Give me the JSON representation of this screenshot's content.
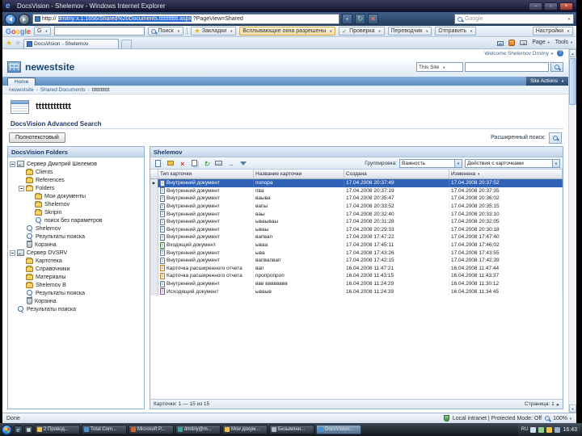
{
  "titlebar": {
    "title": "DocsVision - Shelemov - Windows Internet Explorer"
  },
  "addressbar": {
    "url_prefix": "http://",
    "url_selected": "dmitriy:x.1:1656/Shared%20Documents.tttttttttttt.aspx",
    "url_suffix": "?PageView=Shared",
    "search_placeholder": "Google"
  },
  "google_toolbar": {
    "logo": [
      "G",
      "o",
      "o",
      "g",
      "l",
      "e"
    ],
    "g_button": "G",
    "search_value": "",
    "search_button": "Поиск",
    "bookmarks": "Закладки",
    "popups": "Всплывающие окна разрешены",
    "check": "Проверка",
    "translate": "Переводчик",
    "send": "Отправить",
    "settings": "Настройки"
  },
  "command_bar": {
    "tab_title": "DocsVision - Shelemov",
    "page_menu": "Page",
    "tools_menu": "Tools"
  },
  "portal": {
    "welcome": "Welcome Shelemov Dmitriy",
    "site_title": "newestsite",
    "search_scope": "This Site",
    "nav_home": "Home",
    "site_actions": "Site Actions",
    "breadcrumb": [
      "newestsite",
      "Shared Documents",
      "tttttttttttt"
    ],
    "page_title": "tttttttttttt"
  },
  "search_section": {
    "title": "DocsVision Advanced Search",
    "fulltext_button": "Полнотекстовый",
    "advanced_label": "Расширенный поиск:"
  },
  "folders_panel": {
    "title": "DocsVision Folders",
    "items": [
      {
        "label": "Сервер Дмитрий Шелемов",
        "level": 0,
        "icon": "server",
        "exp": "minus"
      },
      {
        "label": "Clients",
        "level": 1,
        "icon": "folder",
        "exp": "leaf"
      },
      {
        "label": "References",
        "level": 1,
        "icon": "folder",
        "exp": "leaf"
      },
      {
        "label": "Folders",
        "level": 1,
        "icon": "folder-open",
        "exp": "minus"
      },
      {
        "label": "Мои документы",
        "level": 2,
        "icon": "folder",
        "exp": "leaf"
      },
      {
        "label": "Shelemov",
        "level": 2,
        "icon": "folder",
        "exp": "leaf"
      },
      {
        "label": "Skripin",
        "level": 2,
        "icon": "folder",
        "exp": "leaf"
      },
      {
        "label": "поиск без параметров",
        "level": 2,
        "icon": "search",
        "exp": "leaf"
      },
      {
        "label": "Shelemov",
        "level": 1,
        "icon": "search",
        "exp": "leaf"
      },
      {
        "label": "Результаты поиска",
        "level": 1,
        "icon": "search",
        "exp": "leaf"
      },
      {
        "label": "Корзина",
        "level": 1,
        "icon": "bin",
        "exp": "leaf"
      },
      {
        "label": "Сервер DVSRV",
        "level": 0,
        "icon": "server",
        "exp": "minus"
      },
      {
        "label": "Картотека",
        "level": 1,
        "icon": "folder",
        "exp": "leaf"
      },
      {
        "label": "Справочники",
        "level": 1,
        "icon": "folder",
        "exp": "leaf"
      },
      {
        "label": "Материалы",
        "level": 1,
        "icon": "folder",
        "exp": "leaf"
      },
      {
        "label": "Shelemov B",
        "level": 1,
        "icon": "folder",
        "exp": "leaf"
      },
      {
        "label": "Результаты поиска",
        "level": 1,
        "icon": "search",
        "exp": "leaf"
      },
      {
        "label": "Корзина",
        "level": 1,
        "icon": "bin",
        "exp": "leaf"
      },
      {
        "label": "Результаты поиска",
        "level": 0,
        "icon": "search",
        "exp": "leaf"
      }
    ]
  },
  "grid_panel": {
    "title": "Shelemov",
    "toolbar_icons": [
      "new-card",
      "open-card",
      "delete-card",
      "copy-card",
      "refresh",
      "print",
      "export",
      "filter"
    ],
    "grouping_label": "Группировка:",
    "grouping_value": "Важность",
    "actions_value": "Действия с карточками",
    "columns": [
      "Тип карточки",
      "Название карточки",
      "Создана",
      "Изменена"
    ],
    "rows": [
      {
        "type": "Внутренний документ",
        "name": "попора",
        "created": "17.04.2008 20:37:49",
        "modified": "17.04.2008 20:37:52",
        "icon": "doc",
        "selected": true
      },
      {
        "type": "Внутренний документ",
        "name": "пва",
        "created": "17.04.2008 20:37:19",
        "modified": "17.04.2008 20:37:35",
        "icon": "doc",
        "selected": false
      },
      {
        "type": "Внутренний документ",
        "name": "ваыва",
        "created": "17.04.2008 20:35:47",
        "modified": "17.04.2008 20:36:02",
        "icon": "doc",
        "selected": false
      },
      {
        "type": "Внутренний документ",
        "name": "вапы",
        "created": "17.04.2008 20:33:52",
        "modified": "17.04.2008 20:35:15",
        "icon": "doc",
        "selected": false
      },
      {
        "type": "Внутренний документ",
        "name": "ваы",
        "created": "17.04.2008 20:32:40",
        "modified": "17.04.2008 20:33:10",
        "icon": "doc",
        "selected": false
      },
      {
        "type": "Внутренний документ",
        "name": "ываываы",
        "created": "17.04.2008 20:31:28",
        "modified": "17.04.2008 20:32:05",
        "icon": "doc",
        "selected": false
      },
      {
        "type": "Внутренний документ",
        "name": "ываы",
        "created": "17.04.2008 20:29:33",
        "modified": "17.04.2008 20:30:18",
        "icon": "doc",
        "selected": false
      },
      {
        "type": "Внутренний документ",
        "name": "вапвап",
        "created": "17.04.2008 17:47:22",
        "modified": "17.04.2008 17:47:40",
        "icon": "doc",
        "selected": false
      },
      {
        "type": "Входящий документ",
        "name": "ываа",
        "created": "17.04.2008 17:45:11",
        "modified": "17.04.2008 17:46:02",
        "icon": "in",
        "selected": false
      },
      {
        "type": "Внутренний документ",
        "name": "ыва",
        "created": "17.04.2008 17:43:26",
        "modified": "17.04.2008 17:43:55",
        "icon": "doc",
        "selected": false
      },
      {
        "type": "Внутренний документ",
        "name": "вапвапвап",
        "created": "17.04.2008 17:42:15",
        "modified": "17.04.2008 17:42:39",
        "icon": "doc",
        "selected": false
      },
      {
        "type": "Карточка расширенного отчета",
        "name": "вап",
        "created": "16.04.2008 11:47:21",
        "modified": "16.04.2008 11:47:44",
        "icon": "report",
        "selected": false
      },
      {
        "type": "Карточка расширенного отчета",
        "name": "пропропроп",
        "created": "16.04.2008 11:43:15",
        "modified": "16.04.2008 11:43:37",
        "icon": "report",
        "selected": false
      },
      {
        "type": "Внутренний документ",
        "name": "ввв вввввввв",
        "created": "16.04.2008 11:24:29",
        "modified": "16.04.2008 11:30:12",
        "icon": "doc",
        "selected": false
      },
      {
        "type": "Исходящий документ",
        "name": "ываыв",
        "created": "16.04.2008 11:24:39",
        "modified": "16.04.2008 11:34:45",
        "icon": "out",
        "selected": false
      }
    ],
    "footer_left": "Карточки: 1 — 15 из 15",
    "footer_right": "Страница: 1"
  },
  "statusbar": {
    "status": "Done",
    "zone": "Local intranet | Protected Mode: Off",
    "zoom": "100%"
  },
  "taskbar": {
    "buttons": [
      {
        "label": "2 Провод...",
        "c": "gold",
        "active": false
      },
      {
        "label": "Total Com...",
        "c": "blue",
        "active": false
      },
      {
        "label": "Microsoft P...",
        "c": "orange",
        "active": false
      },
      {
        "label": "dmitriy@m...",
        "c": "teal",
        "active": false
      },
      {
        "label": "Мои докум...",
        "c": "gold",
        "active": false
      },
      {
        "label": "Безымянн...",
        "c": "grey",
        "active": false
      },
      {
        "label": "DocsVision...",
        "c": "blue",
        "active": true
      }
    ],
    "tray_language": "RU",
    "clock": "16:43"
  }
}
